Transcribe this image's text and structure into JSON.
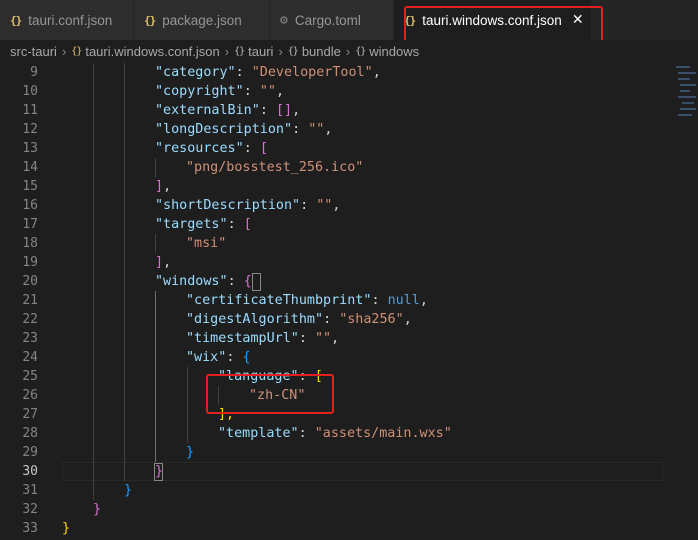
{
  "tabs": [
    {
      "label": "tauri.conf.json",
      "icon": "json-braces-icon",
      "active": false
    },
    {
      "label": "package.json",
      "icon": "json-braces-icon",
      "active": false
    },
    {
      "label": "Cargo.toml",
      "icon": "gear-icon",
      "active": false
    },
    {
      "label": "tauri.windows.conf.json",
      "icon": "json-braces-icon",
      "active": true,
      "close_glyph": "✕"
    }
  ],
  "breadcrumb": {
    "items": [
      "src-tauri",
      "tauri.windows.conf.json",
      "tauri",
      "bundle",
      "windows"
    ],
    "separator": "›",
    "json_icon": "{}"
  },
  "editor": {
    "current_line": 30,
    "lines": [
      {
        "num": "9"
      },
      {
        "num": "10"
      },
      {
        "num": "11"
      },
      {
        "num": "12"
      },
      {
        "num": "13"
      },
      {
        "num": "14"
      },
      {
        "num": "15"
      },
      {
        "num": "16"
      },
      {
        "num": "17"
      },
      {
        "num": "18"
      },
      {
        "num": "19"
      },
      {
        "num": "20"
      },
      {
        "num": "21"
      },
      {
        "num": "22"
      },
      {
        "num": "23"
      },
      {
        "num": "24"
      },
      {
        "num": "25"
      },
      {
        "num": "26"
      },
      {
        "num": "27"
      },
      {
        "num": "28"
      },
      {
        "num": "29"
      },
      {
        "num": "30"
      },
      {
        "num": "31"
      },
      {
        "num": "32"
      },
      {
        "num": "33"
      }
    ],
    "tokens": {
      "category_key": "\"category\"",
      "category_val": "\"DeveloperTool\"",
      "copyright_key": "\"copyright\"",
      "copyright_val": "\"\"",
      "externalBin_key": "\"externalBin\"",
      "externalBin_val": "[]",
      "longDescription_key": "\"longDescription\"",
      "longDescription_val": "\"\"",
      "resources_key": "\"resources\"",
      "resources_open": "[",
      "resources_item": "\"png/bosstest_256.ico\"",
      "resources_close": "]",
      "shortDescription_key": "\"shortDescription\"",
      "shortDescription_val": "\"\"",
      "targets_key": "\"targets\"",
      "targets_open": "[",
      "targets_item": "\"msi\"",
      "targets_close": "]",
      "windows_key": "\"windows\"",
      "windows_open": "{",
      "certificateThumbprint_key": "\"certificateThumbprint\"",
      "certificateThumbprint_val": "null",
      "digestAlgorithm_key": "\"digestAlgorithm\"",
      "digestAlgorithm_val": "\"sha256\"",
      "timestampUrl_key": "\"timestampUrl\"",
      "timestampUrl_val": "\"\"",
      "wix_key": "\"wix\"",
      "wix_open": "{",
      "language_key": "\"language\"",
      "language_open": "[",
      "language_item": "\"zh-CN\"",
      "language_close": "],",
      "template_key": "\"template\"",
      "template_val": "\"assets/main.wxs\"",
      "wix_close": "}",
      "windows_close": "}",
      "bundle_close": "}",
      "tauri_close": "}",
      "root_close": "}",
      "colon": ": ",
      "comma": ","
    }
  },
  "colors": {
    "annotation": "#e51f1f",
    "json_key": "#9cdcfe",
    "json_string": "#ce9178",
    "json_keyword": "#569cd6"
  }
}
